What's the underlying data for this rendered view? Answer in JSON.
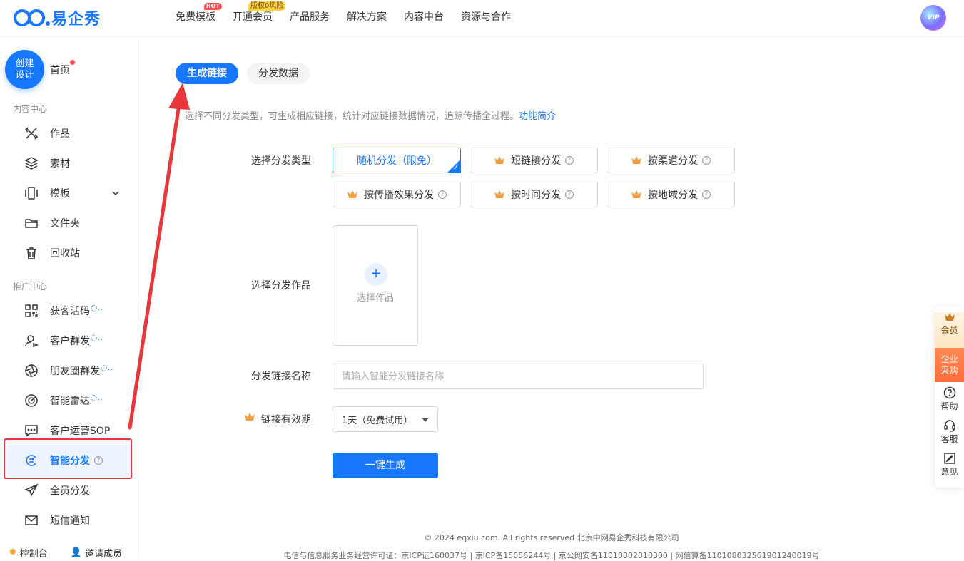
{
  "brand": {
    "name": "易企秀"
  },
  "nav": {
    "items": [
      "免费模板",
      "开通会员",
      "产品服务",
      "解决方案",
      "内容中台",
      "资源与合作"
    ],
    "hot_badge": "HOT",
    "member_badge": "版权0风险"
  },
  "user": {
    "vip_label": "VIP"
  },
  "sidebar": {
    "create_label_1": "创建",
    "create_label_2": "设计",
    "home": "首页",
    "content_section": "内容中心",
    "content_items": [
      "作品",
      "素材",
      "模板",
      "文件夹",
      "回收站"
    ],
    "promo_section": "推广中心",
    "promo_items": [
      "获客活码",
      "客户群发",
      "朋友圈群发",
      "智能雷达",
      "客户运营SOP",
      "智能分发",
      "全员分发",
      "短信通知"
    ],
    "bottom_console": "控制台",
    "bottom_invite": "邀请成员"
  },
  "tabs": {
    "active": "生成链接",
    "inactive": "分发数据"
  },
  "description": {
    "text": "选择不同分发类型，可生成相应链接，统计对应链接数据情况，追踪传播全过程。",
    "link": "功能简介"
  },
  "form": {
    "type_label": "选择分发类型",
    "types": [
      "随机分发（限免）",
      "短链接分发",
      "按渠道分发",
      "按传播效果分发",
      "按时间分发",
      "按地域分发"
    ],
    "work_label": "选择分发作品",
    "work_pick": "选择作品",
    "name_label": "分发链接名称",
    "name_placeholder": "请输入智能分发链接名称",
    "validity_label": "链接有效期",
    "validity_value": "1天（免费试用）",
    "submit": "一键生成"
  },
  "footer": {
    "copyright": "© 2024 eqxiu.com. All rights reserved 北京中网易企秀科技有限公司",
    "license": "电信与信息服务业务经营许可证：京ICP证160037号 | 京ICP备15056244号 | 京公网安备11010802018300 | 网信算备110108032561901240019号"
  },
  "right_float": {
    "vip": "会员",
    "enterprise_1": "企业",
    "enterprise_2": "采购",
    "help": "帮助",
    "service": "客服",
    "feedback": "意见"
  },
  "colors": {
    "primary": "#1677ff",
    "highlight_box": "#e8363a",
    "arrow": "#e8363a"
  }
}
